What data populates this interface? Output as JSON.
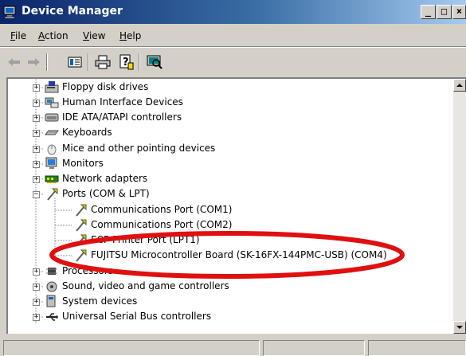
{
  "window": {
    "title": "Device Manager",
    "controls": {
      "minimize": "_",
      "maximize": "□",
      "close": "×"
    }
  },
  "menu": [
    {
      "accel": "F",
      "rest": "ile"
    },
    {
      "accel": "A",
      "rest": "ction"
    },
    {
      "accel": "V",
      "rest": "iew"
    },
    {
      "accel": "H",
      "rest": "elp"
    }
  ],
  "toolbar": {
    "buttons": [
      "back-arrow-icon",
      "forward-arrow-icon",
      "properties-icon",
      "print-icon",
      "help-icon",
      "scan-hardware-icon"
    ]
  },
  "tree": {
    "items": [
      {
        "label": "Floppy disk drives",
        "icon": "floppy-drive-icon",
        "state": "collapsed"
      },
      {
        "label": "Human Interface Devices",
        "icon": "hid-icon",
        "state": "collapsed"
      },
      {
        "label": "IDE ATA/ATAPI controllers",
        "icon": "ide-controller-icon",
        "state": "collapsed"
      },
      {
        "label": "Keyboards",
        "icon": "keyboard-icon",
        "state": "collapsed"
      },
      {
        "label": "Mice and other pointing devices",
        "icon": "mouse-icon",
        "state": "collapsed"
      },
      {
        "label": "Monitors",
        "icon": "monitor-icon",
        "state": "collapsed"
      },
      {
        "label": "Network adapters",
        "icon": "network-adapter-icon",
        "state": "collapsed"
      },
      {
        "label": "Ports (COM & LPT)",
        "icon": "port-icon",
        "state": "expanded"
      },
      {
        "label": "Communications Port (COM1)",
        "icon": "port-icon",
        "state": "child"
      },
      {
        "label": "Communications Port (COM2)",
        "icon": "port-icon",
        "state": "child"
      },
      {
        "label": "ECP Printer Port (LPT1)",
        "icon": "port-icon",
        "state": "child"
      },
      {
        "label": "FUJITSU Microcontroller Board (SK-16FX-144PMC-USB) (COM4)",
        "icon": "port-icon",
        "state": "child"
      },
      {
        "label": "Processors",
        "icon": "processor-icon",
        "state": "collapsed"
      },
      {
        "label": "Sound, video and game controllers",
        "icon": "sound-icon",
        "state": "collapsed"
      },
      {
        "label": "System devices",
        "icon": "system-device-icon",
        "state": "collapsed"
      },
      {
        "label": "Universal Serial Bus controllers",
        "icon": "usb-icon",
        "state": "collapsed"
      }
    ]
  },
  "colors": {
    "titlebar_start": "#0a246a",
    "titlebar_end": "#a6caf0",
    "highlight_oval": "#e01010",
    "chrome": "#d4d0c8"
  }
}
